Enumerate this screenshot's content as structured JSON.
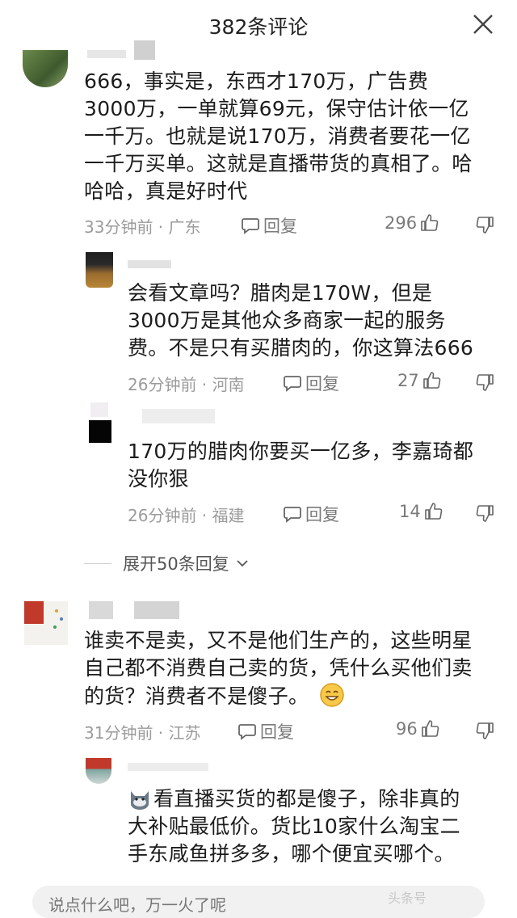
{
  "header": {
    "title": "382条评论"
  },
  "comments": [
    {
      "text_lines": [
        "666，事实是，东西才170万，广告费",
        "3000万，一单就算69元，保守估计依一亿",
        "一千万。也就是说170万，消费者要花一亿",
        "一千万买单。这就是直播带货的真相了。哈",
        "哈哈，真是好时代"
      ],
      "meta": "33分钟前 · 广东",
      "reply_label": "回复",
      "likes": "296"
    },
    {
      "text_lines": [
        "会看文章吗？腊肉是170W，但是",
        "3000万是其他众多商家一起的服务",
        "费。不是只有买腊肉的，你这算法666"
      ],
      "meta": "26分钟前 · 河南",
      "reply_label": "回复",
      "likes": "27"
    },
    {
      "text_lines": [
        "170万的腊肉你要买一亿多，李嘉琦都",
        "没你狠"
      ],
      "meta": "26分钟前 · 福建",
      "reply_label": "回复",
      "likes": "14"
    },
    {
      "text_lines": [
        "谁卖不是卖，又不是他们生产的，这些明星",
        "自己都不消费自己卖的货，凭什么买他们卖",
        "的货？消费者不是傻子。"
      ],
      "meta": "31分钟前 · 江苏",
      "reply_label": "回复",
      "likes": "96"
    },
    {
      "text_lines": [
        "看直播买货的都是傻子，除非真的",
        "大补贴最低价。货比10家什么淘宝二",
        "手东咸鱼拼多多，哪个便宜买哪个。"
      ]
    }
  ],
  "expand": {
    "label": "展开50条回复"
  },
  "input": {
    "placeholder": "说点什么吧，万一火了呢"
  },
  "watermark": "头条号"
}
